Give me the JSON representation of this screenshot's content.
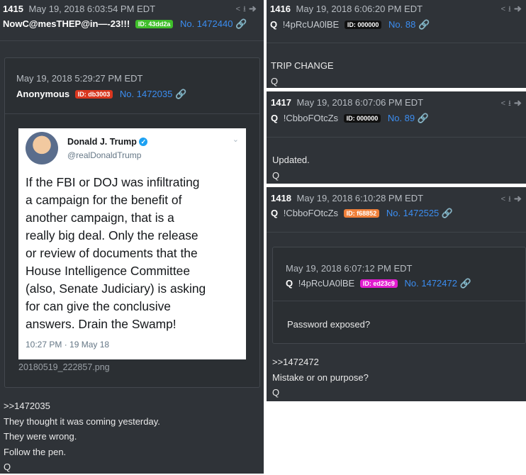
{
  "post1415": {
    "num": "1415",
    "date": "May 19, 2018 6:03:54 PM EDT",
    "author": "NowC@mesTHEP@in—-23!!!",
    "id_badge": "ID: 43dd2a",
    "post_no": "No. 1472440",
    "quoted": {
      "date": "May 19, 2018 5:29:27 PM EDT",
      "author": "Anonymous",
      "id_badge": "ID: db3003",
      "post_no": "No. 1472035",
      "image_caption": "20180519_222857.png",
      "tweet": {
        "name": "Donald J. Trump",
        "handle": "@realDonaldTrump",
        "lines": [
          "If the FBI or DOJ was infiltrating",
          "a campaign for the benefit of",
          "another campaign, that is a",
          "really big deal. Only the release",
          "or review of documents that the",
          "House Intelligence Committee",
          "(also, Senate Judiciary) is asking",
          "for can give the conclusive",
          "answers. Drain the Swamp!"
        ],
        "time": "10:27 PM · 19 May 18"
      }
    },
    "lines": [
      ">>1472035",
      "They thought it was coming yesterday.",
      "They were wrong.",
      "Follow the pen.",
      "Q"
    ]
  },
  "post1416": {
    "num": "1416",
    "date": "May 19, 2018 6:06:20 PM EDT",
    "author": "Q",
    "trip": "!4pRcUA0lBE",
    "id_badge": "ID: 000000",
    "post_no": "No. 88",
    "lines": [
      "TRIP CHANGE",
      "Q"
    ]
  },
  "post1417": {
    "num": "1417",
    "date": "May 19, 2018 6:07:06 PM EDT",
    "author": "Q",
    "trip": "!CbboFOtcZs",
    "id_badge": "ID: 000000",
    "post_no": "No. 89",
    "lines": [
      "Updated.",
      "Q"
    ]
  },
  "post1418": {
    "num": "1418",
    "date": "May 19, 2018 6:10:28 PM EDT",
    "author": "Q",
    "trip": "!CbboFOtcZs",
    "id_badge": "ID: f68852",
    "post_no": "No. 1472525",
    "quoted": {
      "date": "May 19, 2018 6:07:12 PM EDT",
      "author": "Q",
      "trip": "!4pRcUA0lBE",
      "id_badge": "ID: ed23c9",
      "post_no": "No. 1472472",
      "text": "Password exposed?"
    },
    "lines": [
      ">>1472472",
      "Mistake or on purpose?",
      "Q"
    ]
  },
  "colors": {
    "post_bg": "#2f3338",
    "link": "#3b8df0",
    "badge_green": "#3fbf2a",
    "badge_red": "#d9361e",
    "badge_black": "#111111",
    "badge_orange": "#f0803a",
    "badge_magenta": "#e11ccf"
  },
  "icons": [
    "share-icon",
    "download-icon",
    "forward-icon",
    "link-icon",
    "verified-badge-icon",
    "chevron-down-icon"
  ]
}
